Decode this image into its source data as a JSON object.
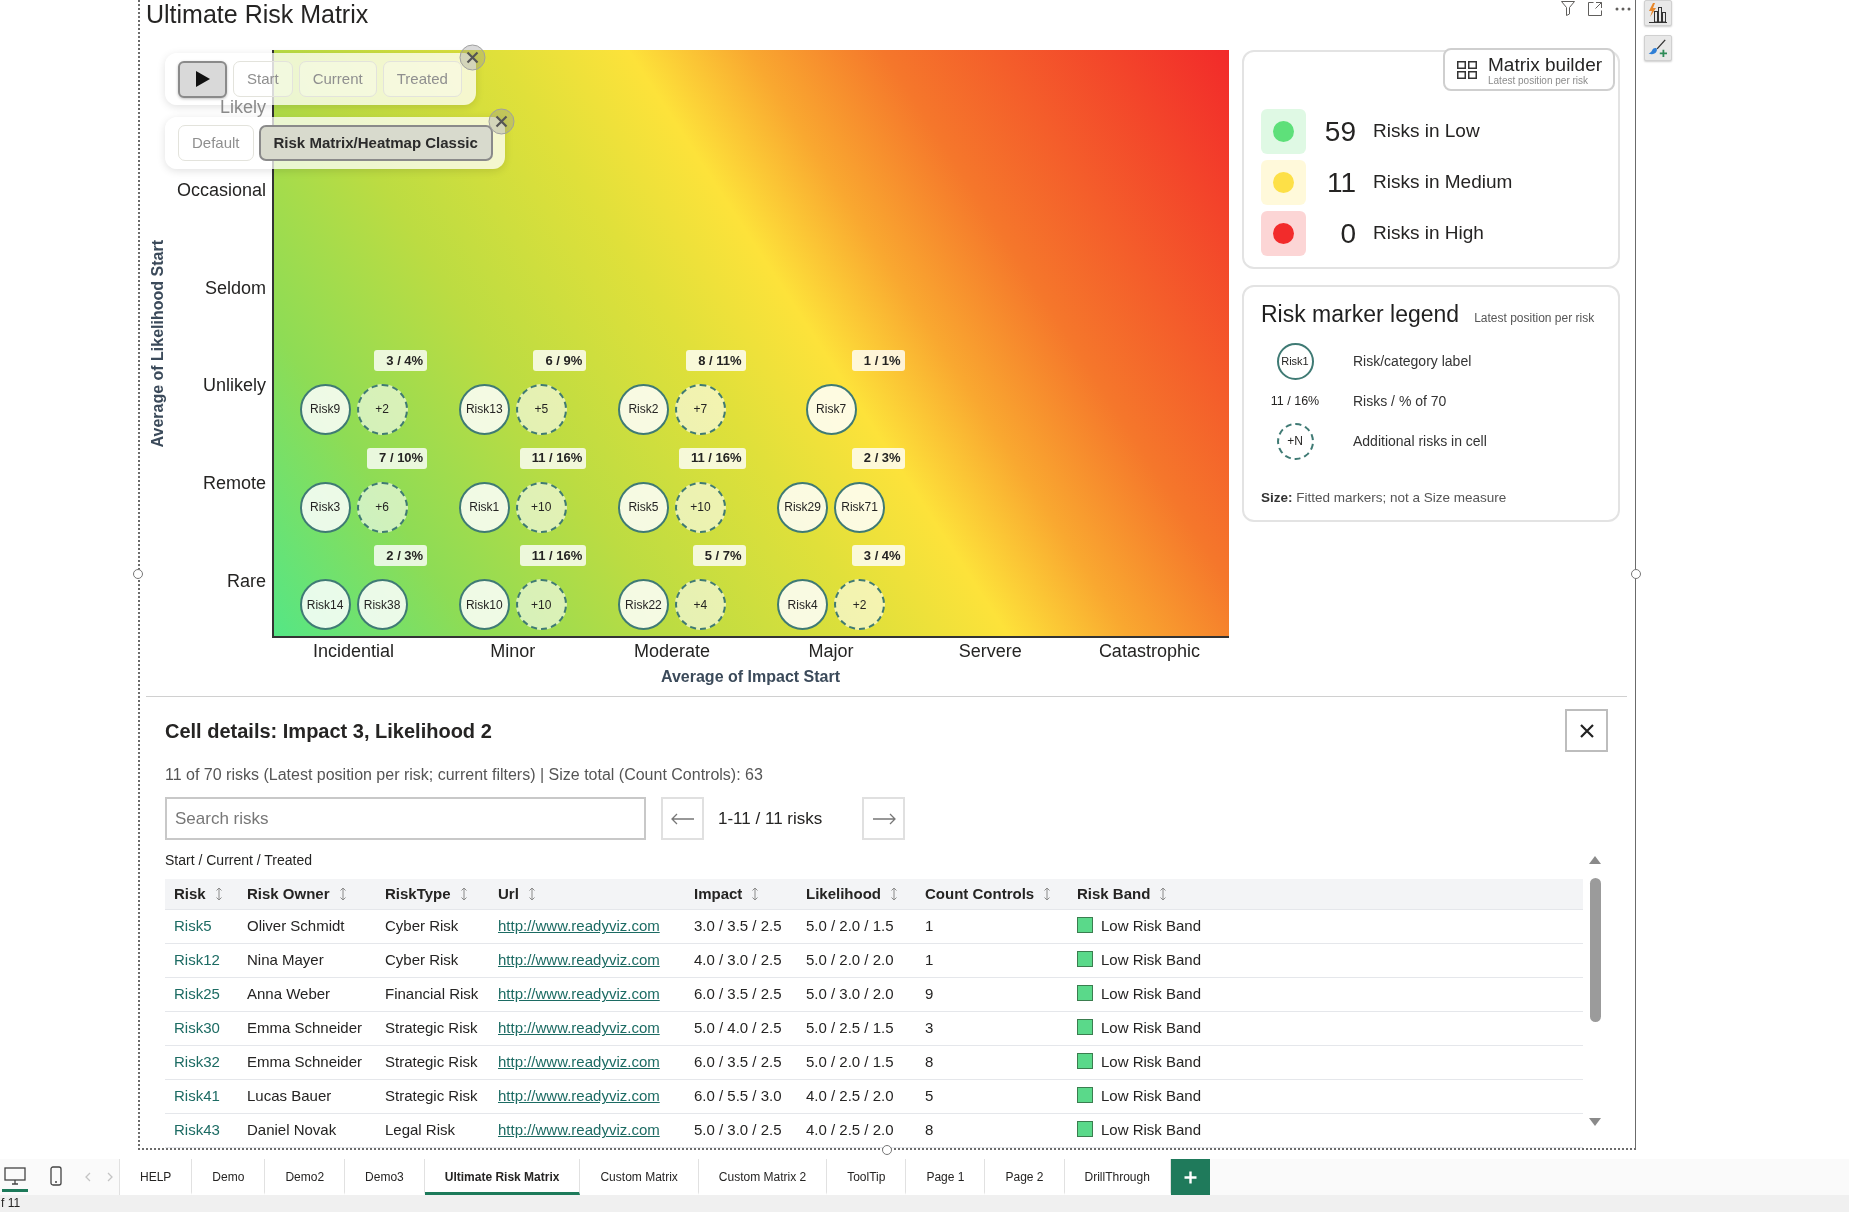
{
  "visual": {
    "title": "Ultimate Risk Matrix"
  },
  "playback": {
    "buttons": [
      {
        "label": "Start",
        "selected": false
      },
      {
        "label": "Current",
        "selected": false
      },
      {
        "label": "Treated",
        "selected": false
      }
    ]
  },
  "presets": {
    "buttons": [
      {
        "label": "Default",
        "selected": false
      },
      {
        "label": "Risk Matrix/Heatmap Classic",
        "selected": true
      }
    ]
  },
  "matrix": {
    "y_axis_title": "Average of Likelihood Start",
    "x_axis_title": "Average of Impact Start",
    "columns": [
      "Incidential",
      "Minor",
      "Moderate",
      "Major",
      "Servere",
      "Catastrophic"
    ],
    "rows": [
      {
        "label": "Likely"
      },
      {
        "label": "Occasional"
      },
      {
        "label": "Seldom"
      },
      {
        "label": "Unlikely",
        "cells": [
          {
            "count": "3 / 4%",
            "markers": [
              {
                "kind": "risk",
                "label": "Risk9"
              },
              {
                "kind": "more",
                "label": "+2"
              }
            ]
          },
          {
            "count": "6 / 9%",
            "markers": [
              {
                "kind": "risk",
                "label": "Risk13"
              },
              {
                "kind": "more",
                "label": "+5"
              }
            ]
          },
          {
            "count": "8 / 11%",
            "markers": [
              {
                "kind": "risk",
                "label": "Risk2"
              },
              {
                "kind": "more",
                "label": "+7"
              }
            ]
          },
          {
            "count": "1 / 1%",
            "markers": [
              {
                "kind": "risk",
                "label": "Risk7"
              }
            ]
          }
        ]
      },
      {
        "label": "Remote",
        "cells": [
          {
            "count": "7 / 10%",
            "markers": [
              {
                "kind": "risk",
                "label": "Risk3"
              },
              {
                "kind": "more",
                "label": "+6"
              }
            ]
          },
          {
            "count": "11 / 16%",
            "markers": [
              {
                "kind": "risk",
                "label": "Risk1"
              },
              {
                "kind": "more",
                "label": "+10"
              }
            ]
          },
          {
            "count": "11 / 16%",
            "markers": [
              {
                "kind": "risk",
                "label": "Risk5"
              },
              {
                "kind": "more",
                "label": "+10"
              }
            ]
          },
          {
            "count": "2 / 3%",
            "markers": [
              {
                "kind": "risk",
                "label": "Risk29"
              },
              {
                "kind": "risk",
                "label": "Risk71"
              }
            ]
          }
        ]
      },
      {
        "label": "Rare",
        "cells": [
          {
            "count": "2 / 3%",
            "markers": [
              {
                "kind": "risk",
                "label": "Risk14"
              },
              {
                "kind": "risk",
                "label": "Risk38"
              }
            ]
          },
          {
            "count": "11 / 16%",
            "markers": [
              {
                "kind": "risk",
                "label": "Risk10"
              },
              {
                "kind": "more",
                "label": "+10"
              }
            ]
          },
          {
            "count": "5 / 7%",
            "markers": [
              {
                "kind": "risk",
                "label": "Risk22"
              },
              {
                "kind": "more",
                "label": "+4"
              }
            ]
          },
          {
            "count": "3 / 4%",
            "markers": [
              {
                "kind": "risk",
                "label": "Risk4"
              },
              {
                "kind": "more",
                "label": "+2"
              }
            ]
          }
        ]
      }
    ]
  },
  "matrix_builder": {
    "label": "Matrix builder",
    "note": "Latest position per risk"
  },
  "summary": {
    "bands": [
      {
        "count": "59",
        "label": "Risks in Low",
        "color": "#5ee07a"
      },
      {
        "count": "11",
        "label": "Risks in Medium",
        "color": "#fde047"
      },
      {
        "count": "0",
        "label": "Risks in High",
        "color": "#f22b2b"
      }
    ]
  },
  "legend": {
    "title": "Risk marker legend",
    "subtitle": "Latest position per risk",
    "items": [
      {
        "kind": "risk",
        "symbol": "Risk1",
        "label": "Risk/category label"
      },
      {
        "kind": "count",
        "symbol": "11 / 16%",
        "label": "Risks / % of 70"
      },
      {
        "kind": "more",
        "symbol": "+N",
        "label": "Additional risks in cell"
      }
    ],
    "note": "**Size:** Fitted markers; not a Size measure"
  },
  "details": {
    "title": "Cell details: Impact 3, Likelihood 2",
    "summary": "11 of 70 risks (Latest position per risk; current filters) | Size total (Count Controls): 63",
    "search": {
      "placeholder": "Search risks"
    },
    "pager": "1-11 / 11 risks",
    "caption": "Start / Current / Treated",
    "table": {
      "columns": [
        "Risk",
        "Risk Owner",
        "RiskType",
        "Url",
        "Impact",
        "Likelihood",
        "Count Controls",
        "Risk Band"
      ],
      "rows": [
        {
          "risk": "Risk5",
          "owner": "Oliver Schmidt",
          "type": "Cyber Risk",
          "url": "http://www.readyviz.com",
          "impact": "3.0 / 3.5 / 2.5",
          "likelihood": "5.0 / 2.0 / 1.5",
          "controls": "1",
          "band": "Low Risk Band"
        },
        {
          "risk": "Risk12",
          "owner": "Nina Mayer",
          "type": "Cyber Risk",
          "url": "http://www.readyviz.com",
          "impact": "4.0 / 3.0 / 2.5",
          "likelihood": "5.0 / 2.0 / 2.0",
          "controls": "1",
          "band": "Low Risk Band"
        },
        {
          "risk": "Risk25",
          "owner": "Anna Weber",
          "type": "Financial Risk",
          "url": "http://www.readyviz.com",
          "impact": "6.0 / 3.5 / 2.5",
          "likelihood": "5.0 / 3.0 / 2.0",
          "controls": "9",
          "band": "Low Risk Band"
        },
        {
          "risk": "Risk30",
          "owner": "Emma Schneider",
          "type": "Strategic Risk",
          "url": "http://www.readyviz.com",
          "impact": "5.0 / 4.0 / 2.5",
          "likelihood": "5.0 / 2.5 / 1.5",
          "controls": "3",
          "band": "Low Risk Band"
        },
        {
          "risk": "Risk32",
          "owner": "Emma Schneider",
          "type": "Strategic Risk",
          "url": "http://www.readyviz.com",
          "impact": "6.0 / 3.5 / 2.5",
          "likelihood": "5.0 / 2.0 / 1.5",
          "controls": "8",
          "band": "Low Risk Band"
        },
        {
          "risk": "Risk41",
          "owner": "Lucas Bauer",
          "type": "Strategic Risk",
          "url": "http://www.readyviz.com",
          "impact": "6.0 / 5.5 / 3.0",
          "likelihood": "4.0 / 2.5 / 2.0",
          "controls": "5",
          "band": "Low Risk Band"
        },
        {
          "risk": "Risk43",
          "owner": "Daniel Novak",
          "type": "Legal Risk",
          "url": "http://www.readyviz.com",
          "impact": "5.0 / 3.0 / 2.5",
          "likelihood": "4.0 / 2.5 / 2.0",
          "controls": "8",
          "band": "Low Risk Band"
        }
      ]
    }
  },
  "page_tabs": {
    "views": [
      {
        "kind": "desktop",
        "selected": true
      },
      {
        "kind": "phone",
        "selected": false
      }
    ],
    "tabs": [
      {
        "label": "HELP",
        "selected": false
      },
      {
        "label": "Demo",
        "selected": false
      },
      {
        "label": "Demo2",
        "selected": false
      },
      {
        "label": "Demo3",
        "selected": false
      },
      {
        "label": "Ultimate Risk Matrix",
        "selected": true
      },
      {
        "label": "Custom Matrix",
        "selected": false
      },
      {
        "label": "Custom Matrix 2",
        "selected": false
      },
      {
        "label": "ToolTip",
        "selected": false
      },
      {
        "label": "Page 1",
        "selected": false
      },
      {
        "label": "Page 2",
        "selected": false
      },
      {
        "label": "DrillThrough",
        "selected": false
      }
    ]
  },
  "status_bar": {
    "text": "f 11"
  }
}
